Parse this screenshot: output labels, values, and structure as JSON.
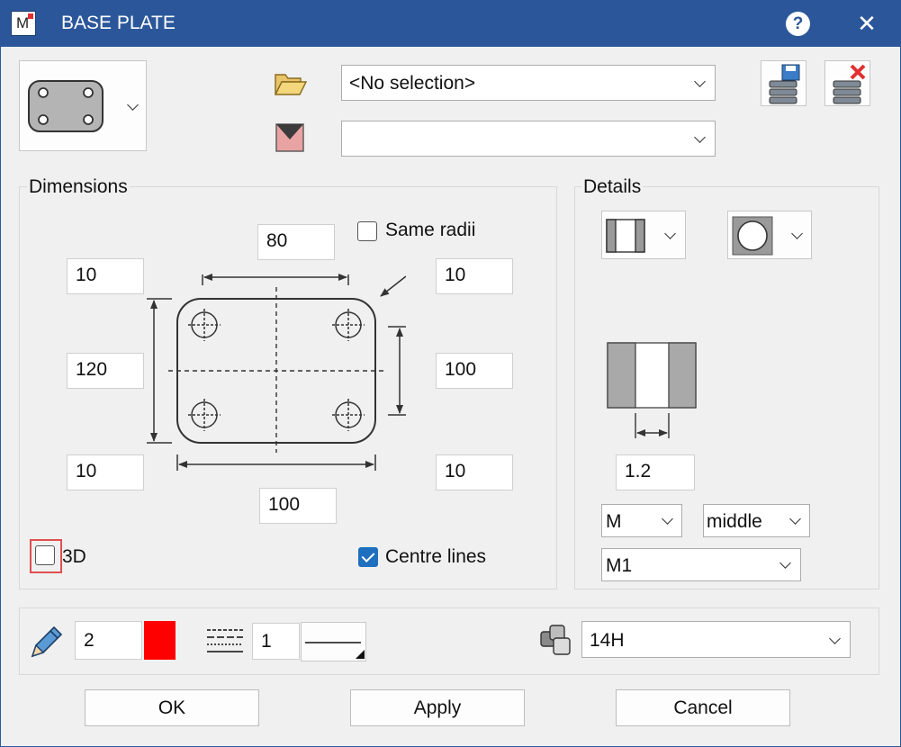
{
  "window": {
    "title": "BASE PLATE",
    "help_label": "?",
    "close_label": "✕"
  },
  "top": {
    "selection_value": "<No selection>",
    "second_value": ""
  },
  "dimensions": {
    "label": "Dimensions",
    "top_width": "80",
    "left_top": "10",
    "left_height": "120",
    "left_bottom": "10",
    "bottom_width": "100",
    "right_top": "10",
    "right_height": "100",
    "right_bottom": "10",
    "same_radii_label": "Same radii",
    "same_radii_checked": false,
    "three_d_label": "3D",
    "three_d_checked": false,
    "centre_lines_label": "Centre lines",
    "centre_lines_checked": true
  },
  "details": {
    "label": "Details",
    "thickness_value": "1.2",
    "material_value": "M",
    "position_value": "middle",
    "layer_value": "M1"
  },
  "bottom": {
    "pen_value": "2",
    "pen_color": "#ff0000",
    "line_value": "1",
    "style_value": "14H"
  },
  "buttons": {
    "ok": "OK",
    "apply": "Apply",
    "cancel": "Cancel"
  },
  "colors": {
    "titlebar": "#2b579a",
    "accent": "#1e6fbe",
    "highlight": "#e05050"
  }
}
